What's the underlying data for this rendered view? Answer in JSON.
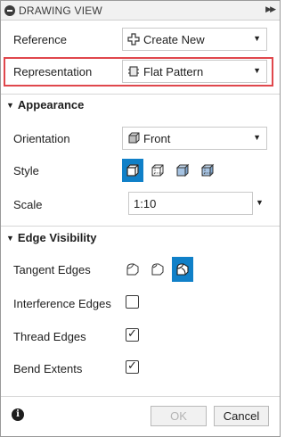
{
  "titlebar": {
    "title": "DRAWING VIEW",
    "collapse_icon": "minus-circle-icon",
    "expand_icon": "double-chevron-right-icon"
  },
  "reference": {
    "label": "Reference",
    "value": "Create New",
    "icon": "plus-icon"
  },
  "representation": {
    "label": "Representation",
    "value": "Flat Pattern",
    "icon": "flat-pattern-icon",
    "highlight_color": "#e0474c"
  },
  "appearance": {
    "header": "Appearance",
    "orientation": {
      "label": "Orientation",
      "value": "Front",
      "icon": "cube-front-icon"
    },
    "style": {
      "label": "Style",
      "options": [
        "visible-edges-icon",
        "visible-and-hidden-edges-icon",
        "shaded-icon",
        "shaded-with-hidden-edges-icon"
      ],
      "selected_index": 0
    },
    "scale": {
      "label": "Scale",
      "value": "1:10"
    }
  },
  "edge_visibility": {
    "header": "Edge Visibility",
    "tangent_edges": {
      "label": "Tangent Edges",
      "options": [
        "tangent-off-icon",
        "tangent-shortened-icon",
        "tangent-full-icon"
      ],
      "selected_index": 2
    },
    "interference_edges": {
      "label": "Interference Edges",
      "checked": false
    },
    "thread_edges": {
      "label": "Thread Edges",
      "checked": true
    },
    "bend_extents": {
      "label": "Bend Extents",
      "checked": true
    }
  },
  "footer": {
    "info_icon": "info-icon",
    "ok_label": "OK",
    "cancel_label": "Cancel"
  },
  "colors": {
    "accent": "#1080c8",
    "highlight": "#e0474c"
  }
}
